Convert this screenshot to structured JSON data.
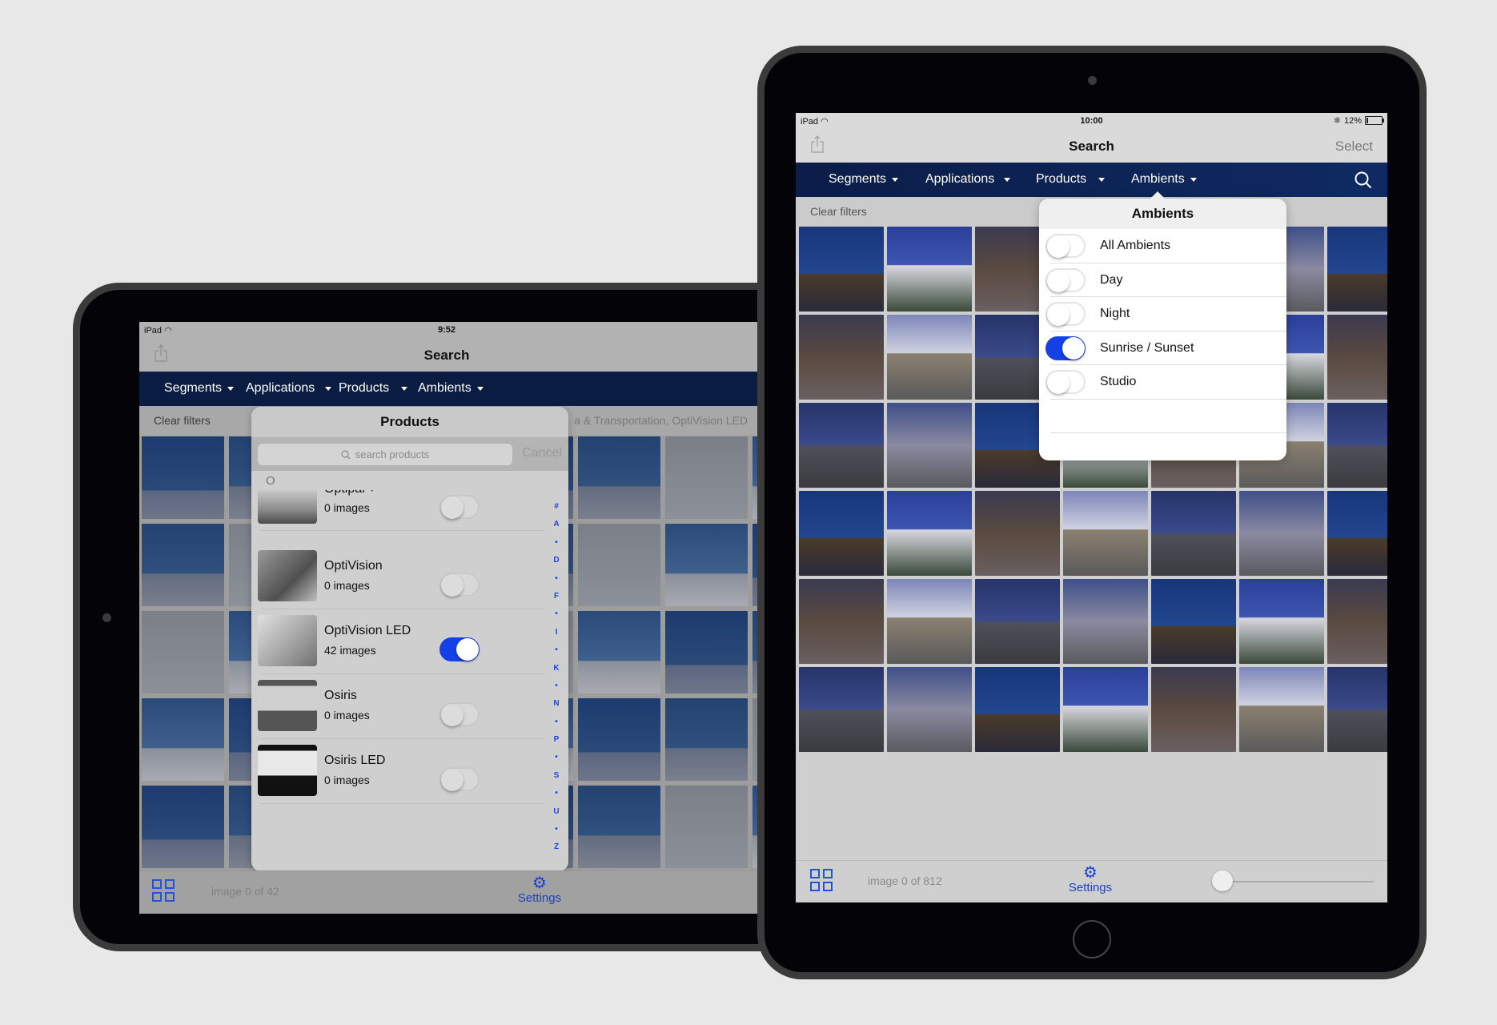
{
  "colors": {
    "background": "#e8e8e8",
    "nav_bar": "#0d2557",
    "accent": "#1440e8",
    "bezel": "#040408",
    "frame_edge": "#3b3b3b"
  },
  "left_ipad": {
    "status": {
      "carrier": "iPad",
      "time": "9:52"
    },
    "header": {
      "title": "Search"
    },
    "nav": [
      {
        "label": "Segments"
      },
      {
        "label": "Applications"
      },
      {
        "label": "Products"
      },
      {
        "label": "Ambients"
      }
    ],
    "filters": {
      "clear_label": "Clear filters",
      "summary": "a & Transportation, OptiVision LED"
    },
    "popover": {
      "title": "Products",
      "search_placeholder": "search products",
      "cancel_label": "Cancel",
      "section_header": "O",
      "items": [
        {
          "name": "Optipal +",
          "count": "0 images",
          "enabled": false,
          "icon": "optipal-luminaire"
        },
        {
          "name": "OptiVision",
          "count": "0 images",
          "enabled": false,
          "icon": "optivision-floodlight"
        },
        {
          "name": "OptiVision LED",
          "count": "42 images",
          "enabled": true,
          "icon": "optivision-led-floodlight"
        },
        {
          "name": "Osiris",
          "count": "0 images",
          "enabled": false,
          "icon": "osiris-lantern"
        },
        {
          "name": "Osiris LED",
          "count": "0 images",
          "enabled": false,
          "icon": "osiris-led-lantern"
        }
      ],
      "index": [
        "#",
        "A",
        "•",
        "D",
        "•",
        "F",
        "•",
        "I",
        "•",
        "K",
        "•",
        "N",
        "•",
        "P",
        "•",
        "S",
        "•",
        "U",
        "•",
        "Z"
      ]
    },
    "toolbar": {
      "image_count": "image 0 of 42",
      "settings_label": "Settings"
    }
  },
  "right_ipad": {
    "status": {
      "carrier": "iPad",
      "time": "10:00",
      "battery": "12%"
    },
    "header": {
      "title": "Search",
      "select_label": "Select"
    },
    "nav": [
      {
        "label": "Segments"
      },
      {
        "label": "Applications"
      },
      {
        "label": "Products"
      },
      {
        "label": "Ambients"
      }
    ],
    "filters": {
      "clear_label": "Clear filters"
    },
    "popover": {
      "title": "Ambients",
      "items": [
        {
          "label": "All Ambients",
          "enabled": false
        },
        {
          "label": "Day",
          "enabled": false
        },
        {
          "label": "Night",
          "enabled": false
        },
        {
          "label": "Sunrise / Sunset",
          "enabled": true
        },
        {
          "label": "Studio",
          "enabled": false
        }
      ]
    },
    "toolbar": {
      "image_count": "image 0 of 812",
      "settings_label": "Settings",
      "thumbnail_size_slider": 0
    }
  }
}
